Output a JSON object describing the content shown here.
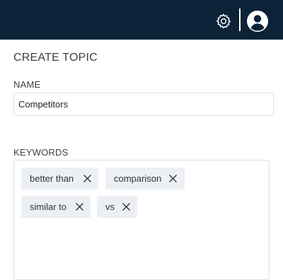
{
  "header": {
    "settings_icon": "gear-icon",
    "profile_icon": "user-circle-icon"
  },
  "form": {
    "title": "CREATE TOPIC",
    "name_label": "NAME",
    "name_value": "Competitors",
    "keywords_label": "KEYWORDS",
    "keywords": [
      {
        "label": "better than"
      },
      {
        "label": "comparison"
      },
      {
        "label": "similar to"
      },
      {
        "label": "vs"
      }
    ]
  },
  "colors": {
    "header_bg": "#0b2238",
    "chip_bg": "#ecf0f4"
  }
}
